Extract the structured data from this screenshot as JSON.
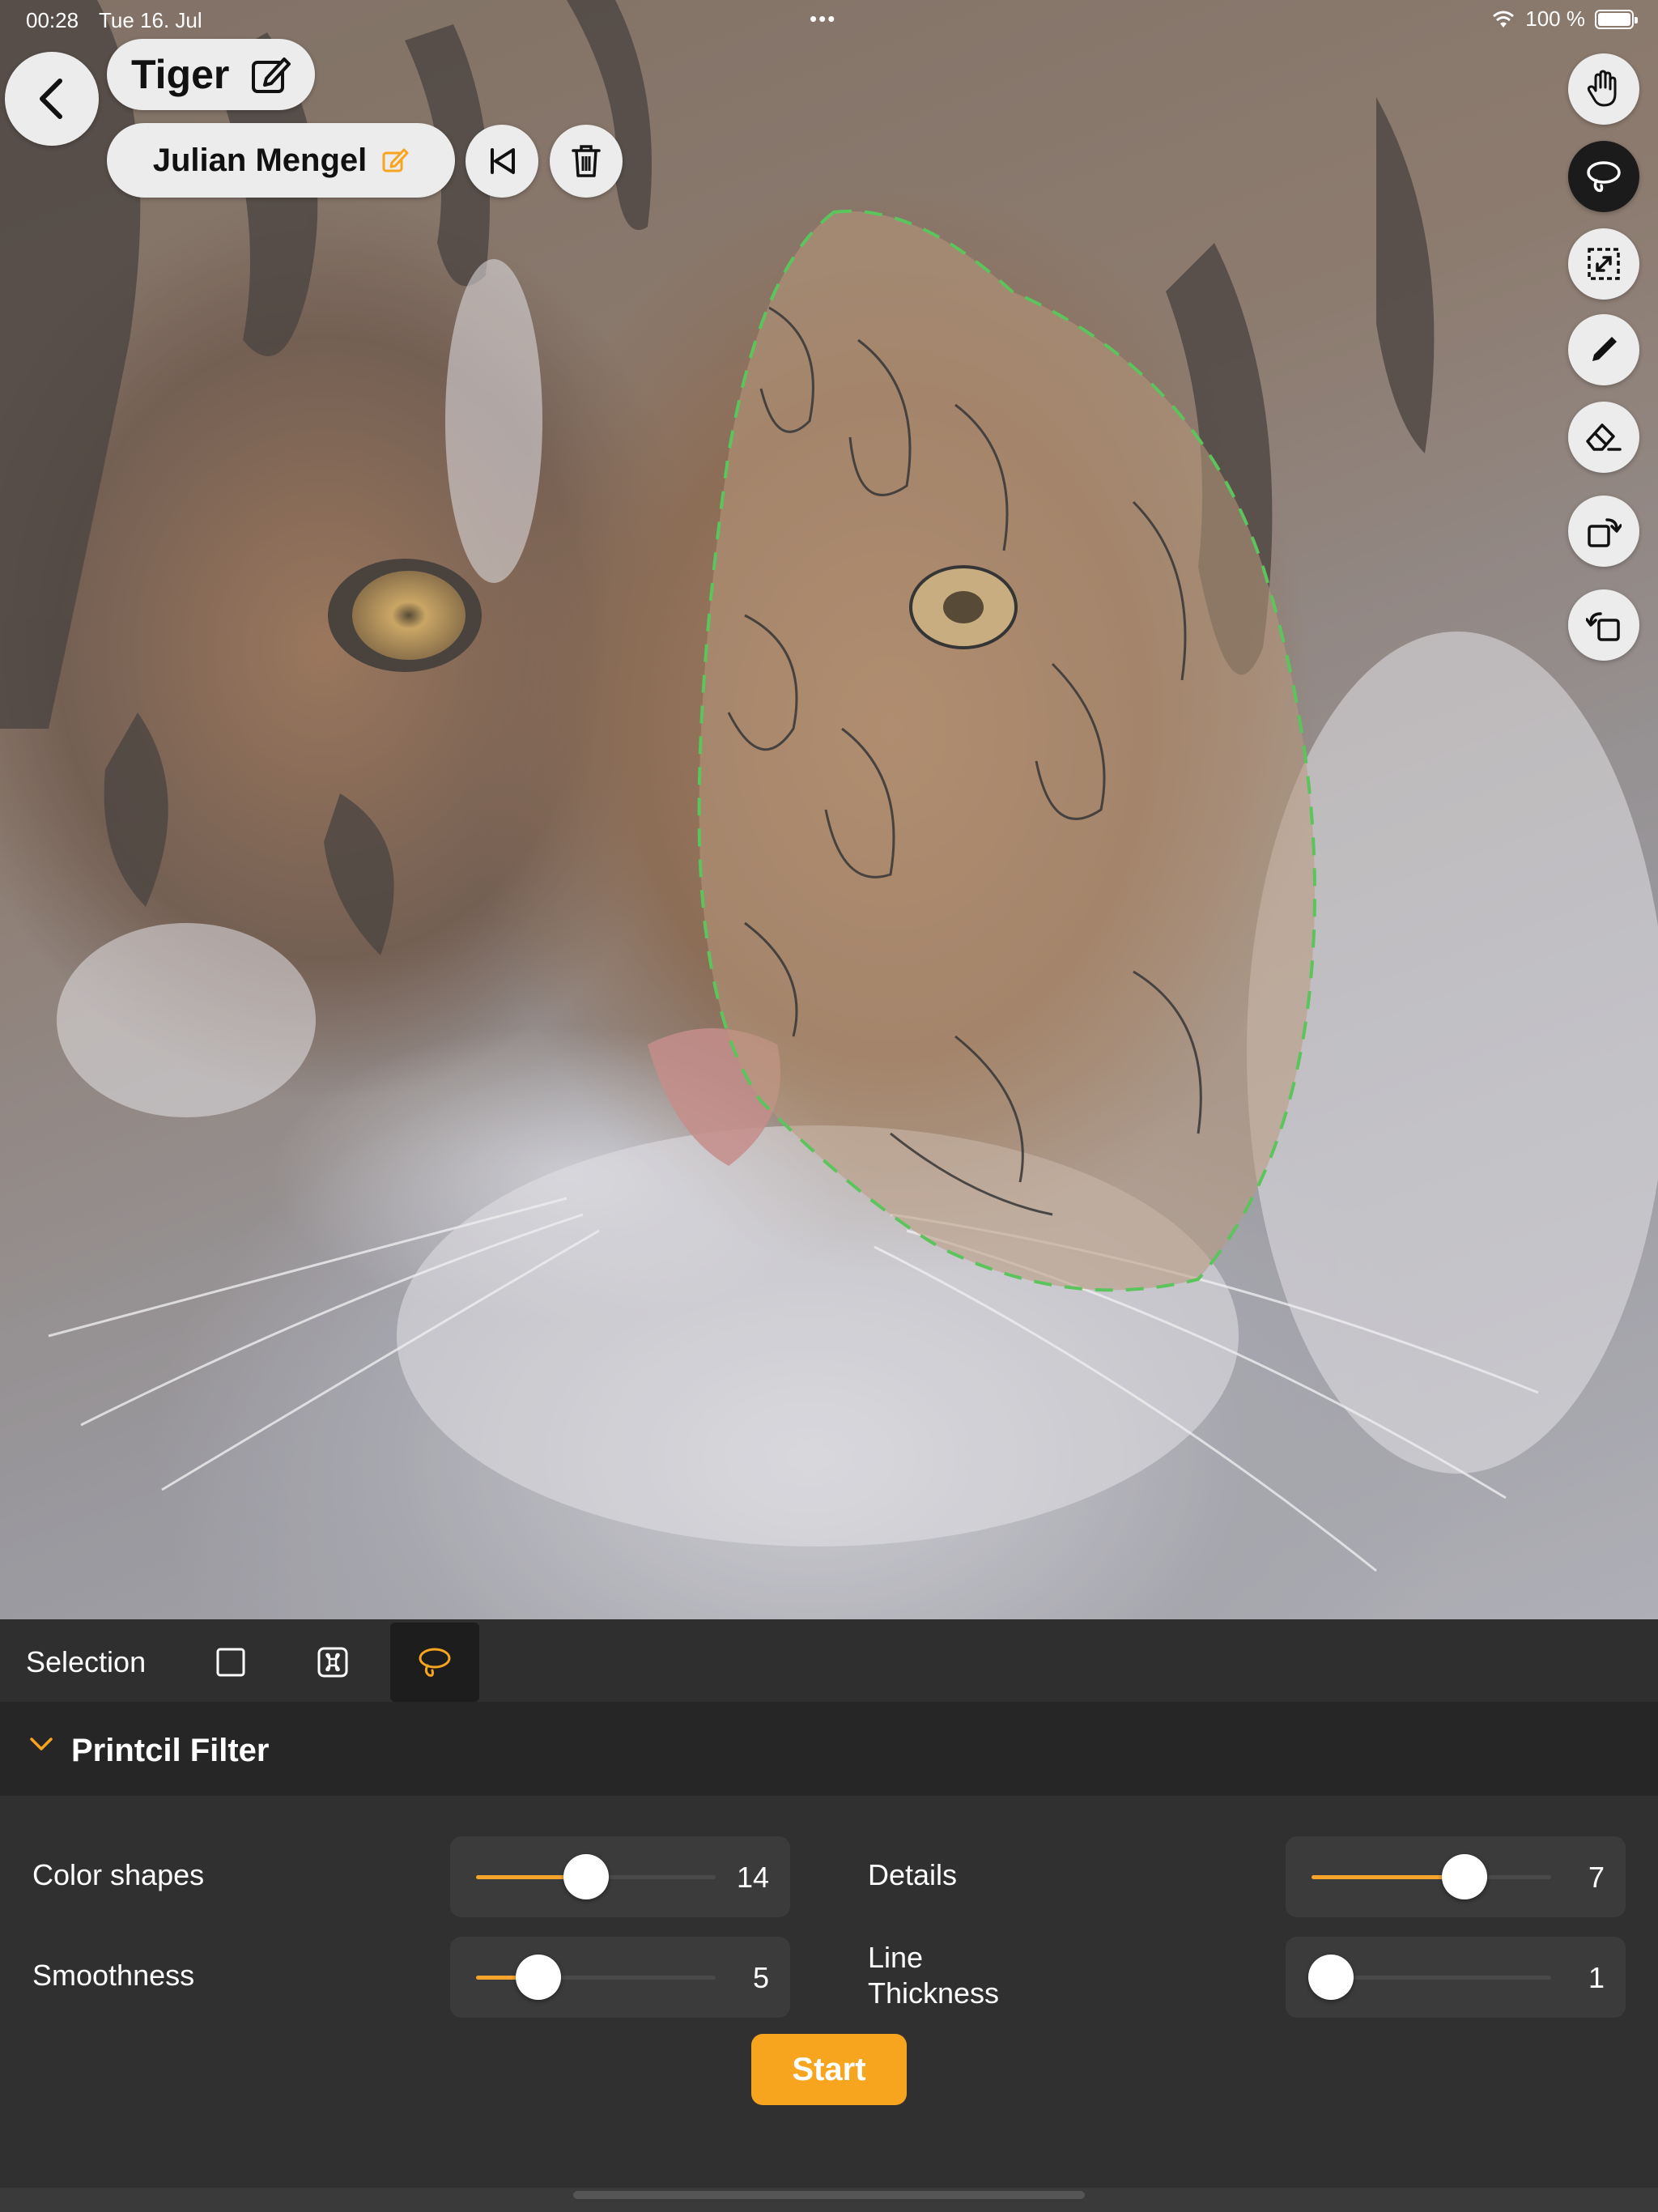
{
  "status_bar": {
    "time": "00:28",
    "date": "Tue 16. Jul",
    "battery": "100 %",
    "center_dots": "•••"
  },
  "document": {
    "title": "Tiger",
    "author": "Julian Mengel"
  },
  "toolbar": {
    "tools": [
      {
        "name": "hand-tool",
        "icon": "hand-icon",
        "active": false
      },
      {
        "name": "lasso-tool",
        "icon": "lasso-icon",
        "active": true
      },
      {
        "name": "resize-tool",
        "icon": "resize-icon",
        "active": false
      },
      {
        "name": "pencil-tool",
        "icon": "pencil-icon",
        "active": false
      },
      {
        "name": "eraser-tool",
        "icon": "eraser-icon",
        "active": false
      },
      {
        "name": "rotate-right-tool",
        "icon": "rotate-right-icon",
        "active": false
      },
      {
        "name": "rotate-left-tool",
        "icon": "rotate-left-icon",
        "active": false
      }
    ]
  },
  "selection": {
    "label": "Selection",
    "modes": [
      "rectangle",
      "object",
      "lasso"
    ],
    "active_mode": "lasso"
  },
  "filter": {
    "title": "Printcil Filter",
    "params": {
      "color_shapes": {
        "label": "Color shapes",
        "value": "14",
        "level": 0.46
      },
      "details": {
        "label": "Details",
        "value": "7",
        "level": 0.64
      },
      "smoothness": {
        "label": "Smoothness",
        "value": "5",
        "level": 0.26
      },
      "line_thickness": {
        "label": "Line\nThickness",
        "value": "1",
        "level": 0.08
      }
    },
    "start_label": "Start"
  },
  "colors": {
    "accent": "#f7a41f",
    "selection_outline": "#3fbf3f",
    "panel": "#303030"
  }
}
